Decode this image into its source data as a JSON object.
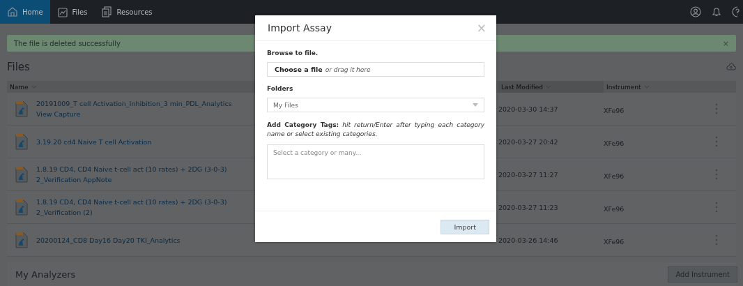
{
  "nav": {
    "tabs": [
      {
        "label": "Home",
        "selected": true
      },
      {
        "label": "Files",
        "selected": false
      },
      {
        "label": "Resources",
        "selected": false
      }
    ]
  },
  "alert": {
    "message": "The file is deleted successfully",
    "close": "×"
  },
  "files": {
    "title": "Files",
    "columns": [
      {
        "label": "Name"
      },
      {
        "label": "Last Modified"
      },
      {
        "label": "Instrument"
      }
    ],
    "rows": [
      {
        "name_lines": [
          "20191009_T cell Activation_Inhibition_3 min_PDL_Analytics",
          "View Capture"
        ],
        "modified": "2020-03-30 14:37",
        "instrument": "XFe96"
      },
      {
        "name_lines": [
          "3.19.20 cd4 Naive T cell Activation"
        ],
        "modified": "2020-03-27 20:42",
        "instrument": "XFe96"
      },
      {
        "name_lines": [
          "1.8.19 CD4, CD4 Naive t-cell act (10 rates) + 2DG (3-0-3)",
          "2_Verification AppNote"
        ],
        "modified": "2020-03-27 11:27",
        "instrument": "XFe96"
      },
      {
        "name_lines": [
          "1.8.19 CD4, CD4 Naive t-cell act (10 rates) + 2DG (3-0-3)",
          "2_Verification (2)"
        ],
        "modified": "2020-03-27 11:23",
        "instrument": "XFe96"
      },
      {
        "name_lines": [
          "20200124_CD8 Day16 Day20 TKI_Analytics"
        ],
        "modified": "2020-03-26 14:46",
        "instrument": "XFe96"
      }
    ]
  },
  "analyzers": {
    "title": "My Analyzers",
    "button": "Add Instrument"
  },
  "modal": {
    "title": "Import Assay",
    "close": "×",
    "browse_label": "Browse to file.",
    "choose_file": "Choose a file",
    "drag_hint": "or drag it here",
    "folders_label": "Folders",
    "folder_value": "My Files",
    "tags_label": "**Add Category Tags:** *hit return/Enter after typing each category name or select existing categories.*",
    "tags_placeholder": "Select a category or many...",
    "button": "Import"
  }
}
